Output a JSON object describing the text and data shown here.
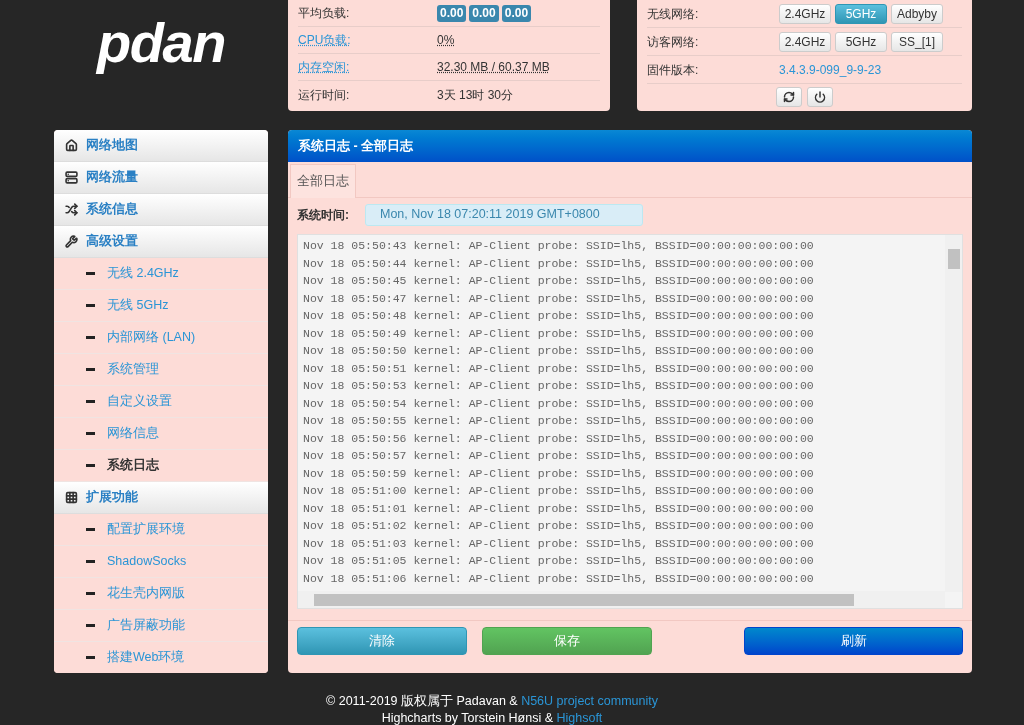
{
  "logo": {
    "text": "pdan"
  },
  "status": {
    "rows": [
      {
        "label": "平均负载:",
        "link": false,
        "badges": [
          "0.00",
          "0.00",
          "0.00"
        ]
      },
      {
        "label": "CPU负载:",
        "link": true,
        "value": "0%"
      },
      {
        "label": "内存空闲:",
        "link": true,
        "value": "32.30 MB / 60.37 MB"
      },
      {
        "label": "运行时间:",
        "link": false,
        "value": "3天 13时 30分"
      }
    ]
  },
  "network": {
    "rows": [
      {
        "label": "无线网络:",
        "buttons": [
          {
            "label": "2.4GHz",
            "selected": false
          },
          {
            "label": "5GHz",
            "selected": true
          },
          {
            "label": "Adbyby",
            "selected": false
          }
        ]
      },
      {
        "label": "访客网络:",
        "buttons": [
          {
            "label": "2.4GHz",
            "selected": false
          },
          {
            "label": "5GHz",
            "selected": false
          },
          {
            "label": "SS_[1]",
            "selected": false
          }
        ]
      },
      {
        "label": "固件版本:",
        "link": "3.4.3.9-099_9-9-23"
      }
    ]
  },
  "sidebar": {
    "sections": [
      {
        "label": "网络地图"
      },
      {
        "label": "网络流量"
      },
      {
        "label": "系统信息"
      },
      {
        "label": "高级设置",
        "children": [
          {
            "label": "无线 2.4GHz",
            "selected": false
          },
          {
            "label": "无线 5GHz",
            "selected": false
          },
          {
            "label": "内部网络 (LAN)",
            "selected": false
          },
          {
            "label": "系统管理",
            "selected": false
          },
          {
            "label": "自定义设置",
            "selected": false
          },
          {
            "label": "网络信息",
            "selected": false
          },
          {
            "label": "系统日志",
            "selected": true
          }
        ]
      },
      {
        "label": "扩展功能",
        "children": [
          {
            "label": "配置扩展环境",
            "selected": false
          },
          {
            "label": "ShadowSocks",
            "selected": false
          },
          {
            "label": "花生壳内网版",
            "selected": false
          },
          {
            "label": "广告屏蔽功能",
            "selected": false
          },
          {
            "label": "搭建Web环境",
            "selected": false
          }
        ]
      }
    ]
  },
  "main": {
    "title": "系统日志 - 全部日志",
    "tabs": [
      {
        "label": "全部日志",
        "selected": true
      }
    ],
    "time_label": "系统时间:",
    "time_value": "Mon, Nov 18 07:20:11 2019 GMT+0800",
    "log": [
      "Nov 18 05:50:43 kernel: AP-Client probe: SSID=lh5, BSSID=00:00:00:00:00:00",
      "Nov 18 05:50:44 kernel: AP-Client probe: SSID=lh5, BSSID=00:00:00:00:00:00",
      "Nov 18 05:50:45 kernel: AP-Client probe: SSID=lh5, BSSID=00:00:00:00:00:00",
      "Nov 18 05:50:47 kernel: AP-Client probe: SSID=lh5, BSSID=00:00:00:00:00:00",
      "Nov 18 05:50:48 kernel: AP-Client probe: SSID=lh5, BSSID=00:00:00:00:00:00",
      "Nov 18 05:50:49 kernel: AP-Client probe: SSID=lh5, BSSID=00:00:00:00:00:00",
      "Nov 18 05:50:50 kernel: AP-Client probe: SSID=lh5, BSSID=00:00:00:00:00:00",
      "Nov 18 05:50:51 kernel: AP-Client probe: SSID=lh5, BSSID=00:00:00:00:00:00",
      "Nov 18 05:50:53 kernel: AP-Client probe: SSID=lh5, BSSID=00:00:00:00:00:00",
      "Nov 18 05:50:54 kernel: AP-Client probe: SSID=lh5, BSSID=00:00:00:00:00:00",
      "Nov 18 05:50:55 kernel: AP-Client probe: SSID=lh5, BSSID=00:00:00:00:00:00",
      "Nov 18 05:50:56 kernel: AP-Client probe: SSID=lh5, BSSID=00:00:00:00:00:00",
      "Nov 18 05:50:57 kernel: AP-Client probe: SSID=lh5, BSSID=00:00:00:00:00:00",
      "Nov 18 05:50:59 kernel: AP-Client probe: SSID=lh5, BSSID=00:00:00:00:00:00",
      "Nov 18 05:51:00 kernel: AP-Client probe: SSID=lh5, BSSID=00:00:00:00:00:00",
      "Nov 18 05:51:01 kernel: AP-Client probe: SSID=lh5, BSSID=00:00:00:00:00:00",
      "Nov 18 05:51:02 kernel: AP-Client probe: SSID=lh5, BSSID=00:00:00:00:00:00",
      "Nov 18 05:51:03 kernel: AP-Client probe: SSID=lh5, BSSID=00:00:00:00:00:00",
      "Nov 18 05:51:05 kernel: AP-Client probe: SSID=lh5, BSSID=00:00:00:00:00:00",
      "Nov 18 05:51:06 kernel: AP-Client probe: SSID=lh5, BSSID=00:00:00:00:00:00"
    ],
    "buttons": [
      {
        "label": "清除",
        "kind": "info"
      },
      {
        "label": "保存",
        "kind": "success"
      },
      {
        "label": "刷新",
        "kind": "primary"
      }
    ]
  },
  "footer": {
    "lines": [
      {
        "text": "© 2011-2019 版权属于 Padavan & ",
        "link": "N56U project community"
      },
      {
        "text": "Highcharts by Torstein Hønsi & ",
        "link": "Highsoft"
      }
    ]
  }
}
